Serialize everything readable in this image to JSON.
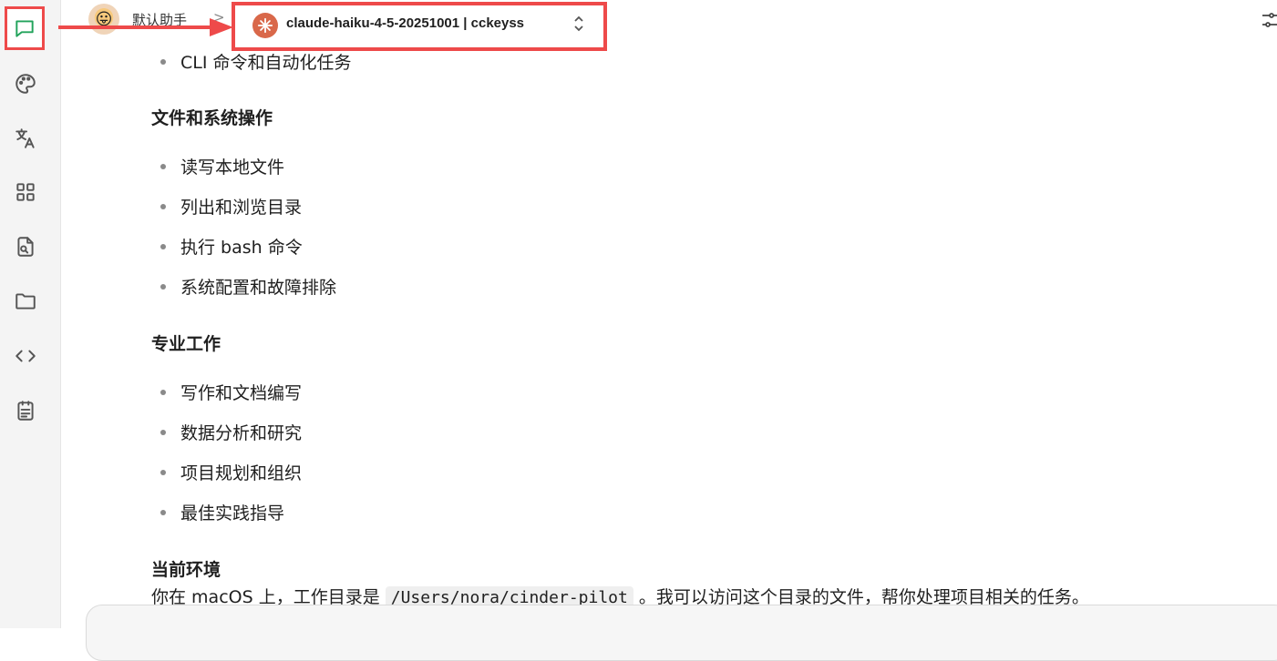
{
  "header": {
    "assistant_name": "默认助手",
    "breadcrumb_separator": ">",
    "model_name": "claude-haiku-4-5-20251001 | cckeyss"
  },
  "sidebar": {
    "items": [
      {
        "icon": "chat-icon",
        "active": true
      },
      {
        "icon": "palette-icon"
      },
      {
        "icon": "translate-icon"
      },
      {
        "icon": "apps-grid-icon"
      },
      {
        "icon": "file-search-icon"
      },
      {
        "icon": "folder-icon"
      },
      {
        "icon": "code-icon"
      },
      {
        "icon": "notes-icon"
      }
    ]
  },
  "message": {
    "partial_item": "CLI 命令和自动化任务",
    "sections": [
      {
        "title": "文件和系统操作",
        "items": [
          "读写本地文件",
          "列出和浏览目录",
          "执行 bash 命令",
          "系统配置和故障排除"
        ]
      },
      {
        "title": "专业工作",
        "items": [
          "写作和文档编写",
          "数据分析和研究",
          "项目规划和组织",
          "最佳实践指导"
        ]
      }
    ],
    "env_title": "当前环境",
    "env_prefix": "你在 macOS 上，工作目录是",
    "env_path": "/Users/nora/cinder-pilot",
    "env_suffix": "。我可以访问这个目录的文件，帮你处理项目相关的任务。"
  },
  "colors": {
    "highlight": "#ee4a4a",
    "active_icon": "#22a35b",
    "model_icon_bg": "#d9684a"
  }
}
